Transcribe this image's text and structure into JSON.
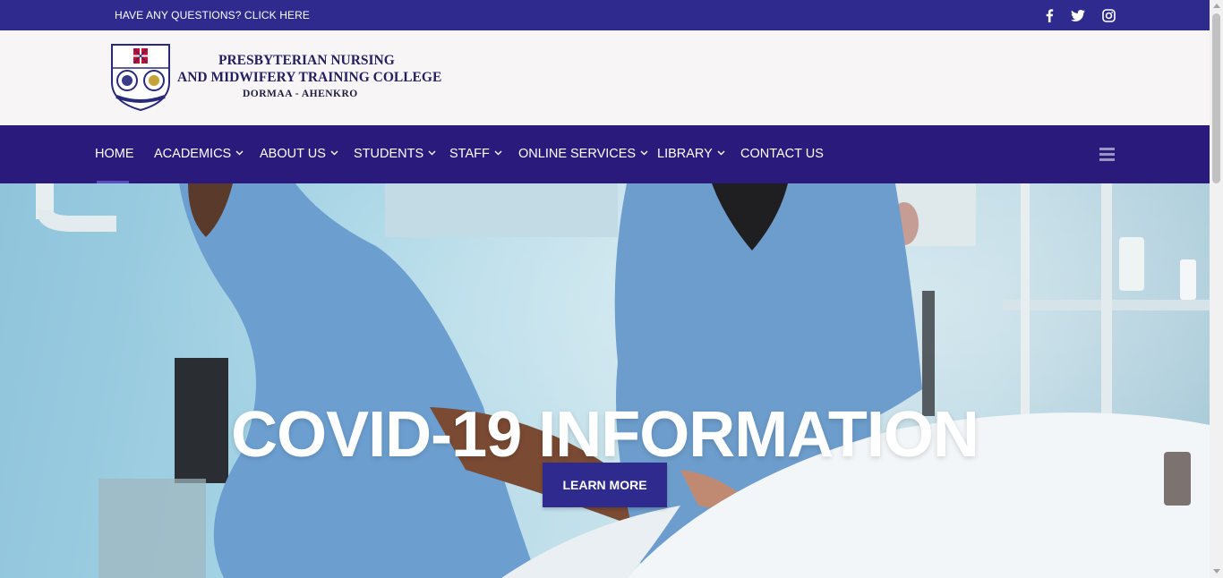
{
  "topbar": {
    "question_link": "HAVE ANY QUESTIONS? CLICK HERE",
    "social_icons": [
      "facebook-icon",
      "twitter-icon",
      "instagram-icon"
    ]
  },
  "logo": {
    "line1": "PRESBYTERIAN NURSING",
    "line2": "AND MIDWIFERY TRAINING COLLEGE",
    "line3": "DORMAA - AHENKRO"
  },
  "nav": {
    "items": [
      {
        "label": "HOME",
        "has_dropdown": false,
        "active": true
      },
      {
        "label": "ACADEMICS",
        "has_dropdown": true
      },
      {
        "label": "ABOUT US",
        "has_dropdown": true
      },
      {
        "label": "STUDENTS",
        "has_dropdown": true
      },
      {
        "label": "STAFF",
        "has_dropdown": true
      },
      {
        "label": "ONLINE SERVICES",
        "has_dropdown": true
      },
      {
        "label": "LIBRARY",
        "has_dropdown": true
      },
      {
        "label": "CONTACT US",
        "has_dropdown": false
      }
    ],
    "menu_icon": "hamburger-menu-icon"
  },
  "hero": {
    "title": "COVID-19 INFORMATION",
    "button_label": "LEARN MORE"
  },
  "colors": {
    "topbar": "#2e2a8e",
    "nav": "#2a1a7c",
    "header_bg": "#f7f5f5",
    "button": "#2e2a8e"
  }
}
